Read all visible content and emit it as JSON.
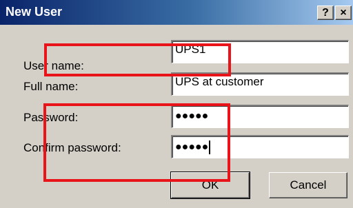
{
  "window": {
    "title": "New User",
    "help_label": "?",
    "close_label": "×"
  },
  "form": {
    "username_label": "User name:",
    "username_value": "UPS1",
    "fullname_label": "Full name:",
    "fullname_value": "UPS at customer",
    "password_label": "Password:",
    "password_mask": "●●●●●",
    "confirm_label": "Confirm password:",
    "confirm_mask": "●●●●●"
  },
  "buttons": {
    "ok_label": "OK",
    "cancel_label": "Cancel"
  },
  "colors": {
    "highlight": "#e8141a",
    "titlebar_start": "#0a246a",
    "face": "#d4d0c8"
  }
}
